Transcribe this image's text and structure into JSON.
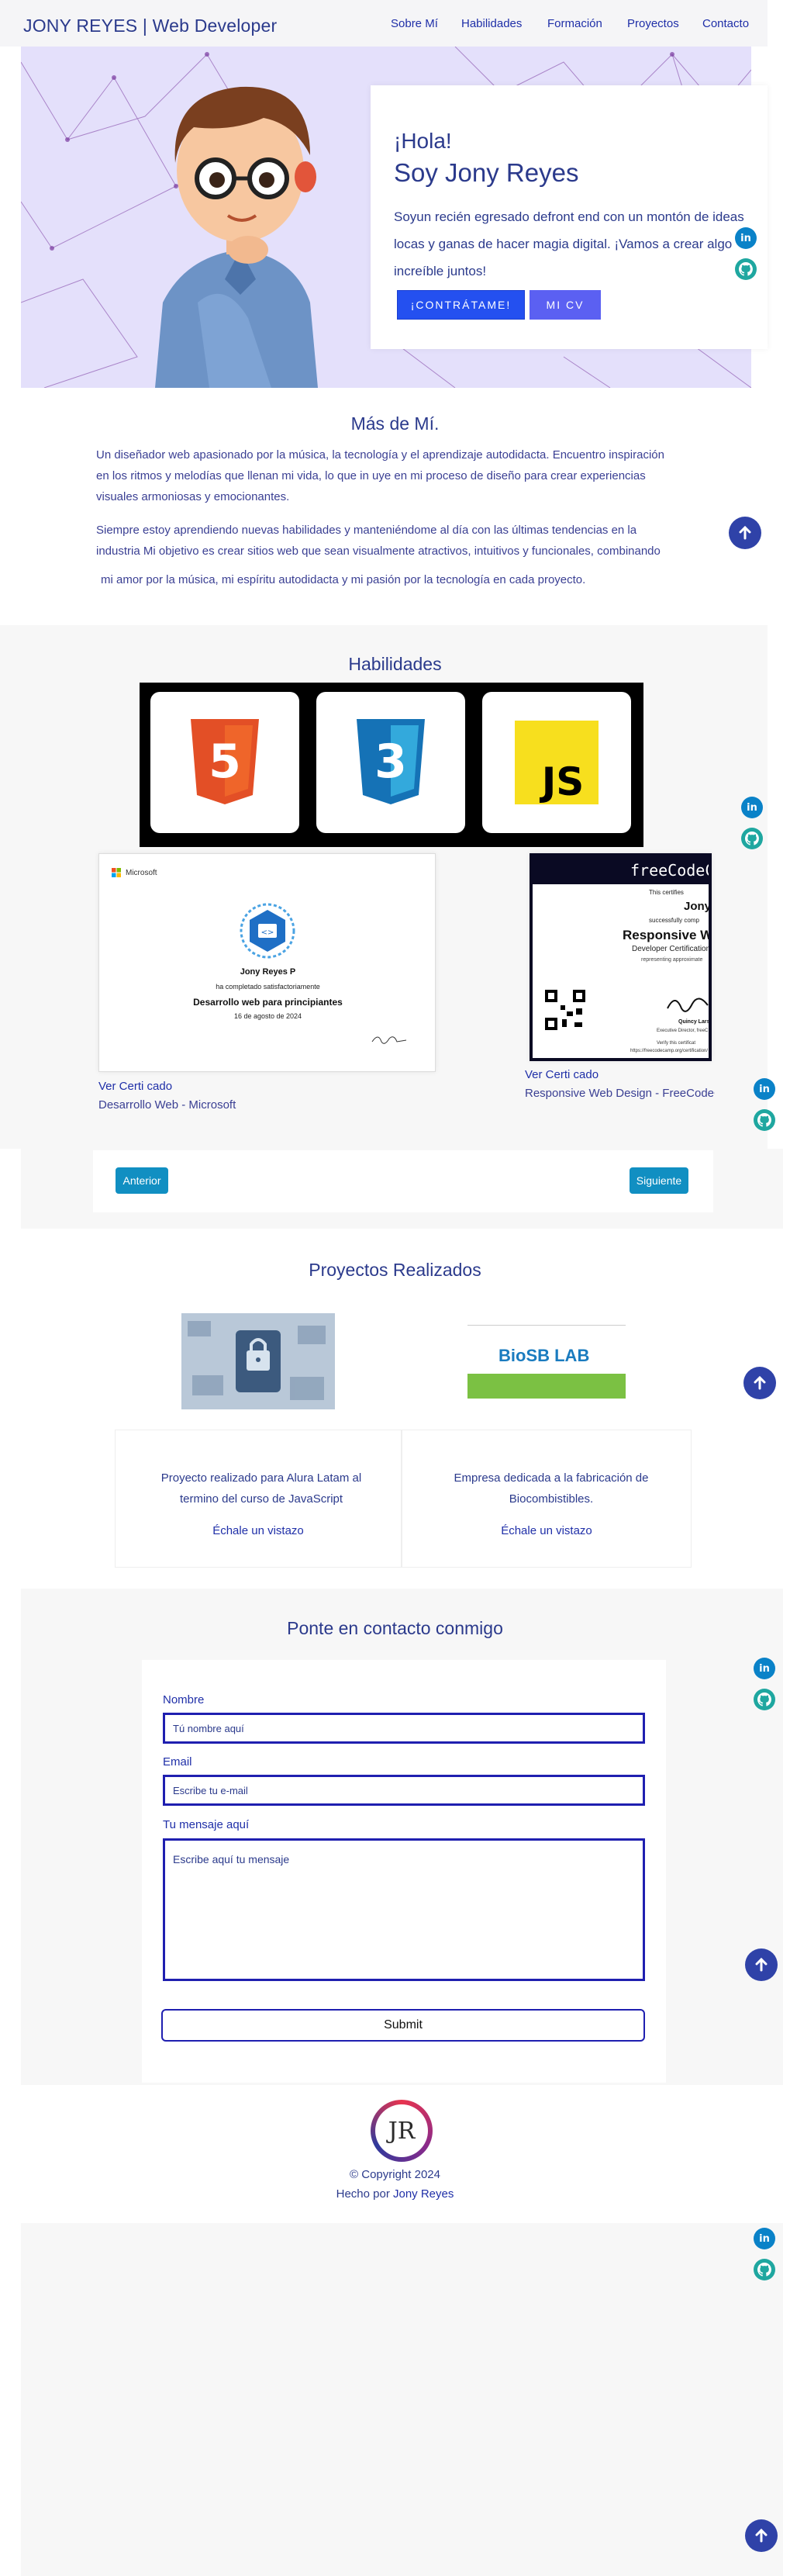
{
  "brand": "JONY REYES | Web Developer",
  "nav": [
    "Sobre Mí",
    "Habilidades",
    "Formación",
    "Proyectos",
    "Contacto"
  ],
  "hero": {
    "greeting": "¡Hola!",
    "name": "Soy Jony Reyes",
    "intro": "Soyun recién egresado defront end con un montón de ideas locas y ganas de hacer magia digital. ¡Vamos a crear algo increíble juntos!",
    "cta_primary": "¡CONTRÁTAME!",
    "cta_cv": "MI CV"
  },
  "about": {
    "title": "Más de Mí.",
    "p1": "Un diseñador web apasionado por la música, la tecnología y el aprendizaje autodidacta. Encuentro inspiración en los ritmos y melodías que llenan mi vida, lo que in uye en mi proceso de diseño para crear experiencias visuales armoniosas y emocionantes.",
    "p2": "Siempre estoy aprendiendo nuevas habilidades y manteniéndome al día con las últimas tendencias en la industria Mi objetivo es crear sitios web que sean visualmente atractivos, intuitivos y funcionales, combinando",
    "p3": "mi amor por la música, mi espíritu autodidacta y mi pasión por la tecnología en cada proyecto."
  },
  "skills": {
    "title": "Habilidades",
    "items": [
      {
        "label": "5",
        "icon": "html5-icon",
        "color": "#e34f26"
      },
      {
        "label": "3",
        "icon": "css3-icon",
        "color": "#1572b6"
      },
      {
        "label": "JS",
        "icon": "javascript-icon",
        "color": "#f7df1e"
      }
    ]
  },
  "certs": [
    {
      "issuer_logo": "Microsoft",
      "holder": "Jony Reyes P",
      "completed": "ha completado satisfactoriamente",
      "course": "Desarrollo web para principiantes",
      "date": "16 de agosto de 2024",
      "link": "Ver Certi cado",
      "subtitle": "Desarrollo Web - Microsoft"
    },
    {
      "header": "freeCodeC",
      "certifies": "This certifies",
      "holder": "Jony",
      "completed": "successfully comp",
      "course": "Responsive W",
      "dev_cert": "Developer Certification",
      "representing": "representing approximate",
      "signer": "Quincy Lars",
      "signer_role": "Executive Director, freeC",
      "verify": "Verify this certificat",
      "url": "https://freecodecamp.org/certification/",
      "link": "Ver Certi cado",
      "subtitle": "Responsive Web Design - FreeCodeC"
    }
  ],
  "pager": {
    "prev": "Anterior",
    "next": "Siguiente"
  },
  "projects": {
    "title": "Proyectos Realizados",
    "items": [
      {
        "desc": "Proyecto realizado para Alura Latam al termino del curso de JavaScript",
        "link": "Échale un vistazo"
      },
      {
        "desc": "Empresa dedicada a la fabricación de Biocombistibles.",
        "link": "Échale un vistazo",
        "logo": "BioSB LAB"
      }
    ]
  },
  "contact": {
    "title": "Ponte en contacto conmigo",
    "name_label": "Nombre",
    "name_placeholder": "Tú nombre aquí",
    "email_label": "Email",
    "email_placeholder": "Escribe tu e-mail",
    "message_label": "Tu mensaje aquí",
    "message_placeholder": "Escribe aquí tu mensaje",
    "submit": "Submit"
  },
  "footer": {
    "logo": "JR",
    "copyright": "© Copyright 2024",
    "made_by_prefix": "Hecho por",
    "made_by_name": "Jony Reyes"
  },
  "colors": {
    "accent": "#2b3a8c",
    "link": "#1f2fa8",
    "hero_bg": "#e4e0fb",
    "button": "#2450f0"
  }
}
